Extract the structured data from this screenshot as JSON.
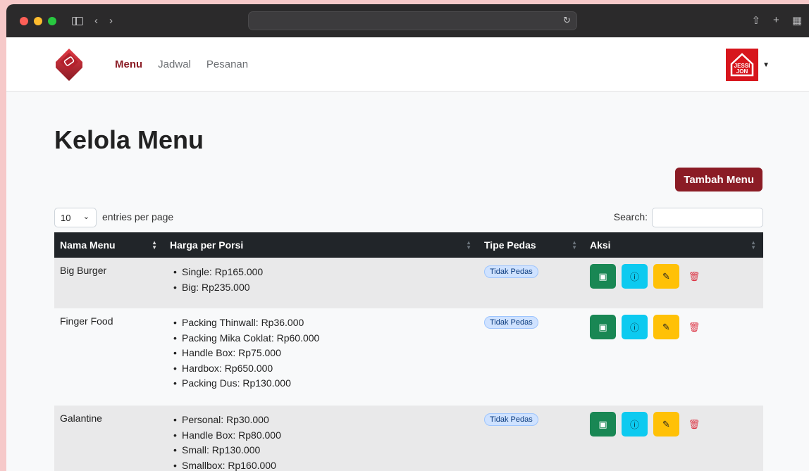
{
  "browser": {
    "url": ""
  },
  "navbar": {
    "links": [
      "Menu",
      "Jadwal",
      "Pesanan"
    ],
    "active": "Menu",
    "avatar_text": "JESSI JON"
  },
  "page": {
    "title": "Kelola Menu",
    "add_button": "Tambah Menu",
    "entries_value": "10",
    "entries_label": "entries per page",
    "search_label": "Search:"
  },
  "table": {
    "headers": [
      "Nama Menu",
      "Harga per Porsi",
      "Tipe Pedas",
      "Aksi"
    ],
    "rows": [
      {
        "name": "Big Burger",
        "prices": [
          "Single: Rp165.000",
          "Big: Rp235.000"
        ],
        "spice": "Tidak Pedas"
      },
      {
        "name": "Finger Food",
        "prices": [
          "Packing Thinwall: Rp36.000",
          "Packing Mika Coklat: Rp60.000",
          "Handle Box: Rp75.000",
          "Hardbox: Rp650.000",
          "Packing Dus: Rp130.000"
        ],
        "spice": "Tidak Pedas"
      },
      {
        "name": "Galantine",
        "prices": [
          "Personal: Rp30.000",
          "Handle Box: Rp80.000",
          "Small: Rp130.000",
          "Smallbox: Rp160.000"
        ],
        "spice": "Tidak Pedas"
      }
    ]
  },
  "colors": {
    "brand": "#8b1c25",
    "header": "#212529"
  }
}
